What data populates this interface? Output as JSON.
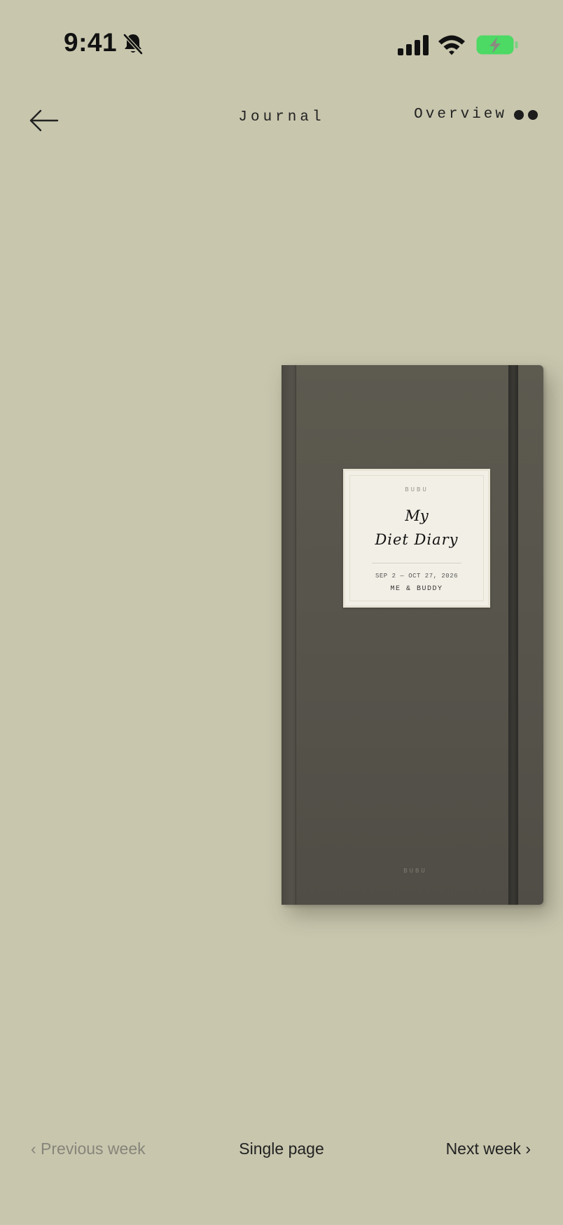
{
  "status_bar": {
    "time": "9:41",
    "icons": [
      "bell-slash-icon",
      "signal-icon",
      "wifi-icon",
      "battery-charging-icon"
    ],
    "battery_color": "#4cd964"
  },
  "nav": {
    "back_icon": "arrow-left-icon",
    "title": "Journal",
    "overview_label": "Overview",
    "overview_icon": "two-dots-icon"
  },
  "journal": {
    "brand": "BUBU",
    "title_line1": "My",
    "title_line2": "Diet Diary",
    "date_range": "SEP 2 — OCT 27, 2026",
    "owner": "ME & BUDDY",
    "footer_brand": "BUBU",
    "cover_color": "#57554c"
  },
  "bottom_nav": {
    "prev_label": "‹ Previous week",
    "center_label": "Single page",
    "next_label": "Next week ›"
  },
  "colors": {
    "background": "#c8c6ad",
    "text_primary": "#222222",
    "text_muted": "#86857a"
  }
}
